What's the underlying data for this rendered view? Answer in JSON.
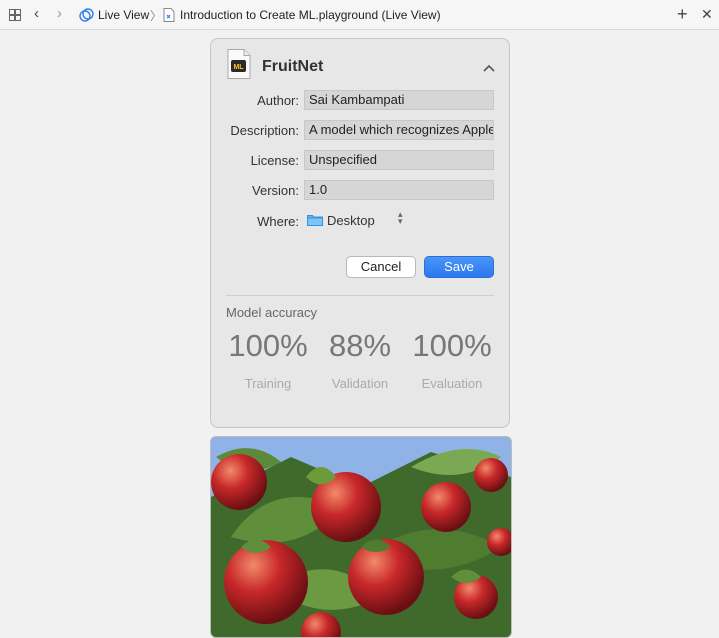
{
  "toolbar": {
    "breadcrumb_1": "Live View",
    "breadcrumb_2": "Introduction to Create ML.playground (Live View)"
  },
  "model": {
    "name": "FruitNet",
    "badge": "ML",
    "fields": {
      "author_label": "Author:",
      "author_value": "Sai Kambampati",
      "description_label": "Description:",
      "description_value": "A model which recognizes Apples",
      "license_label": "License:",
      "license_value": "Unspecified",
      "version_label": "Version:",
      "version_value": "1.0",
      "where_label": "Where:",
      "where_value": "Desktop"
    },
    "buttons": {
      "cancel": "Cancel",
      "save": "Save"
    }
  },
  "accuracy": {
    "title": "Model accuracy",
    "metrics": [
      {
        "value": "100%",
        "label": "Training"
      },
      {
        "value": "88%",
        "label": "Validation"
      },
      {
        "value": "100%",
        "label": "Evaluation"
      }
    ]
  },
  "colors": {
    "accent": "#2f7ff2",
    "panel_bg": "#e7e7e7"
  },
  "icons": [
    "grid-icon",
    "back-icon",
    "forward-icon",
    "live-view-icon",
    "playground-file-icon",
    "plus-icon",
    "close-icon",
    "mlmodel-file-icon",
    "chevron-up-icon",
    "folder-icon",
    "stepper-icon"
  ]
}
